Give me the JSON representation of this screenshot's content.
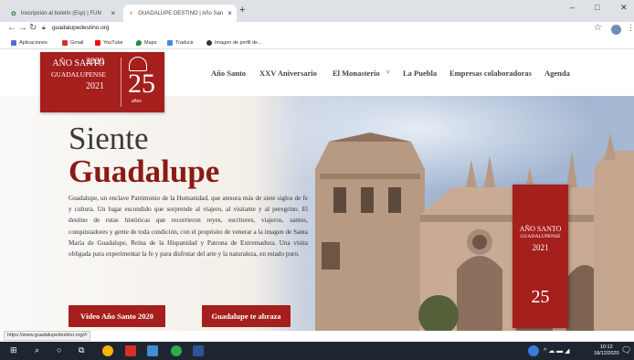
{
  "browser": {
    "tabs": [
      {
        "label": "Inscripción al boletín (Esp) | FUN"
      },
      {
        "label": "GUADALUPE DESTINO | Año San"
      }
    ],
    "new_tab": "+",
    "url": "guadalupedestino.org",
    "window_controls": {
      "minimize": "–",
      "maximize": "□",
      "close": "✕"
    },
    "bookmarks": [
      {
        "label": "Aplicaciones",
        "color": "#4a6fd6"
      },
      {
        "label": "Gmail",
        "color": "#d93025"
      },
      {
        "label": "YouTube",
        "color": "#ff0000"
      },
      {
        "label": "Maps",
        "color": "#1e8e3e"
      },
      {
        "label": "Traducir",
        "color": "#4285f4"
      },
      {
        "label": "Imagen de perfil de...",
        "color": "#333333"
      }
    ]
  },
  "site": {
    "logo": {
      "line1": "AÑO SANTO",
      "line2": "GUADALUPENSE",
      "year_top": "2020",
      "year_bottom": "2021",
      "anniv": "25",
      "anniv_sub": "años"
    },
    "nav": [
      "Año Santo",
      "XXV Aniversario",
      "El Monasterio",
      "La Puebla",
      "Empresas colaboradoras",
      "Agenda"
    ],
    "nav_dropdown_marker": "˅",
    "hero": {
      "title_line1": "Siente",
      "title_line2": "Guadalupe",
      "body": "Guadalupe, un enclave Patrimonio de la Humanidad, que atesora más de siete siglos de fe y cultura. Un lugar escondido que sorprende al viajero, al visitante y al peregrino. El destino de rutas históricas que recorrieron reyes, escritores, viajeros, santos, conquistadores y gente de toda condición, con el propósito de venerar a la imagen de Santa María de Guadalupe, Reina de la Hispanidad y Patrona de Extremadura. Una visita obligada para experimentar la fe y para disfrutar del arte y la naturaleza, en estado puro.",
      "button1": "Vídeo Año Santo 2020",
      "button2": "Guadalupe te abraza"
    },
    "banner": {
      "line1": "AÑO SANTO",
      "line2": "GUADALUPENSE",
      "year": "2021",
      "anniv": "25"
    }
  },
  "status_url": "https://www.guadalupedestino.org/#",
  "taskbar": {
    "time": "10:12",
    "date": "18/12/2020"
  },
  "colors": {
    "brand_red": "#a51f1d",
    "title_red": "#8b1a14"
  }
}
